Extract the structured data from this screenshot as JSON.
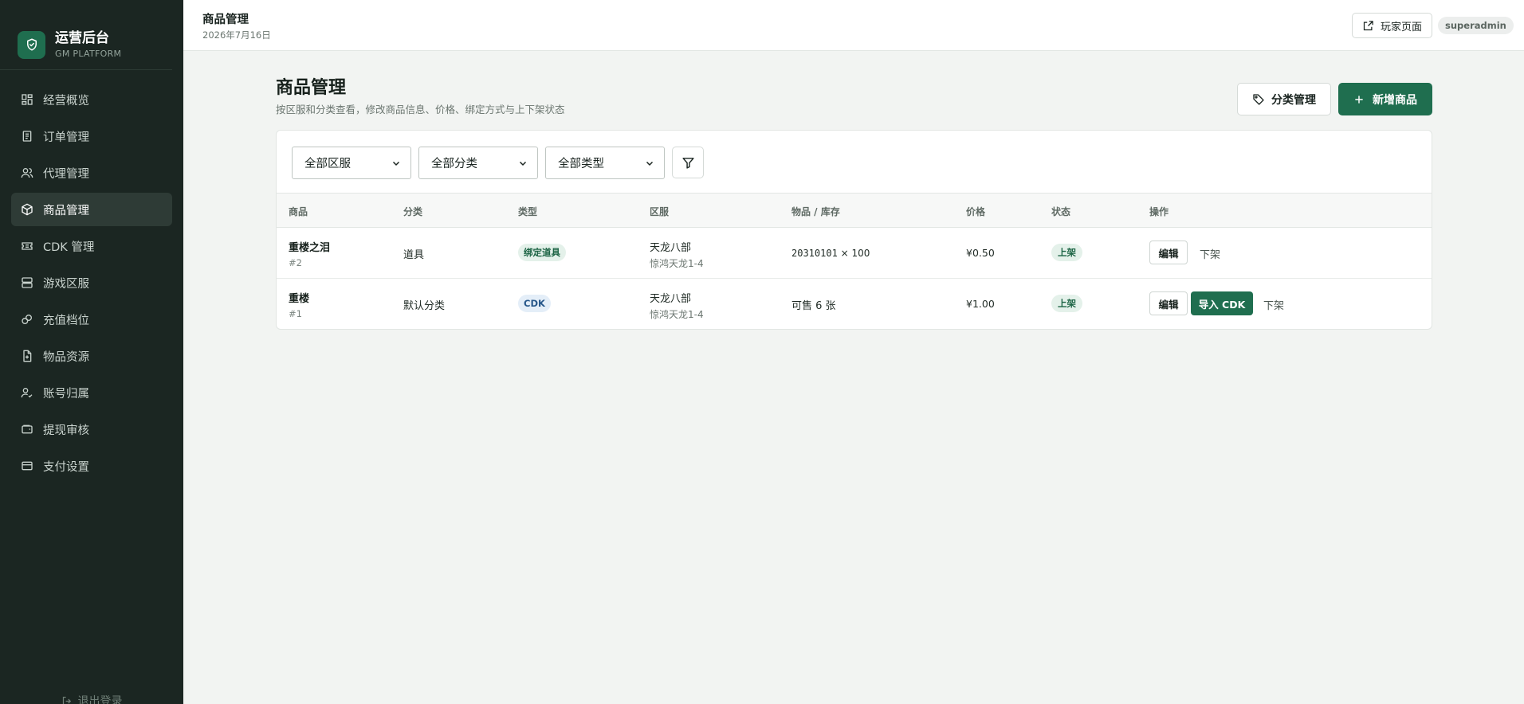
{
  "brand": {
    "title": "运营后台",
    "subtitle": "GM PLATFORM"
  },
  "nav": [
    {
      "label": "经营概览",
      "icon": "dashboard-icon",
      "active": false
    },
    {
      "label": "订单管理",
      "icon": "orders-icon",
      "active": false
    },
    {
      "label": "代理管理",
      "icon": "users-icon",
      "active": false
    },
    {
      "label": "商品管理",
      "icon": "package-icon",
      "active": true
    },
    {
      "label": "CDK 管理",
      "icon": "ticket-icon",
      "active": false
    },
    {
      "label": "游戏区服",
      "icon": "server-icon",
      "active": false
    },
    {
      "label": "充值档位",
      "icon": "coins-icon",
      "active": false
    },
    {
      "label": "物品资源",
      "icon": "file-icon",
      "active": false
    },
    {
      "label": "账号归属",
      "icon": "user-check-icon",
      "active": false
    },
    {
      "label": "提现审核",
      "icon": "wallet-icon",
      "active": false
    },
    {
      "label": "支付设置",
      "icon": "credit-card-icon",
      "active": false
    }
  ],
  "logout_label": "退出登录",
  "header": {
    "title": "商品管理",
    "date": "2026年7月16日",
    "player_page": "玩家页面",
    "user": "superadmin"
  },
  "page": {
    "title": "商品管理",
    "description": "按区服和分类查看，修改商品信息、价格、绑定方式与上下架状态",
    "category_button": "分类管理",
    "add_button": "新增商品"
  },
  "filters": {
    "server": "全部区服",
    "category": "全部分类",
    "type": "全部类型"
  },
  "table": {
    "headers": {
      "product": "商品",
      "category": "分类",
      "type": "类型",
      "server": "区服",
      "stock": "物品 / 库存",
      "price": "价格",
      "status": "状态",
      "actions": "操作"
    },
    "rows": [
      {
        "name": "重楼之泪",
        "id": "#2",
        "category": "道具",
        "type": "绑定道具",
        "server_main": "天龙八部",
        "server_sub": "惊鸿天龙1-4",
        "stock_code": "20310101",
        "stock_qty": " × 100",
        "price": "¥0.50",
        "status": "上架",
        "edit": "编辑",
        "off": "下架"
      },
      {
        "name": "重楼",
        "id": "#1",
        "category": "默认分类",
        "type": "CDK",
        "server_main": "天龙八部",
        "server_sub": "惊鸿天龙1-4",
        "stock_text": "可售 6 张",
        "price": "¥1.00",
        "status": "上架",
        "edit": "编辑",
        "import": "导入 CDK",
        "off": "下架"
      }
    ]
  },
  "colors": {
    "primary": "#1f6e4f",
    "sidebar": "#1b2622"
  }
}
